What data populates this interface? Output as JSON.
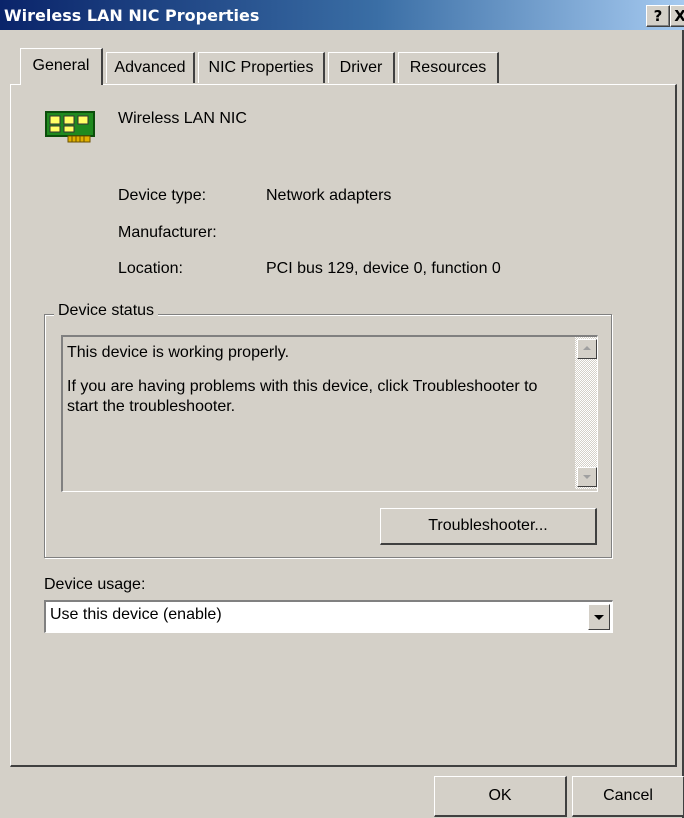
{
  "window": {
    "title": "Wireless LAN NIC Properties",
    "help_button": "?",
    "close_button": "X"
  },
  "tabs": [
    {
      "label": "General",
      "active": true
    },
    {
      "label": "Advanced",
      "active": false
    },
    {
      "label": "NIC Properties",
      "active": false
    },
    {
      "label": "Driver",
      "active": false
    },
    {
      "label": "Resources",
      "active": false
    }
  ],
  "device": {
    "name": "Wireless LAN NIC",
    "icon": "network-card-icon",
    "type_label": "Device type:",
    "type_value": "Network adapters",
    "manufacturer_label": "Manufacturer:",
    "manufacturer_value": "",
    "location_label": "Location:",
    "location_value": "PCI bus 129, device 0, function 0"
  },
  "status_group": {
    "caption": "Device status",
    "line1": "This device is working properly.",
    "line2": "If you are having problems with this device, click Troubleshooter to start the troubleshooter.",
    "troubleshooter_button": "Troubleshooter..."
  },
  "usage": {
    "label": "Device usage:",
    "selected": "Use this device (enable)"
  },
  "footer": {
    "ok_label": "OK",
    "cancel_label": "Cancel"
  },
  "colors": {
    "face": "#d4d0c8",
    "title_bar_start": "#0a246a",
    "title_bar_end": "#a6caf0"
  }
}
